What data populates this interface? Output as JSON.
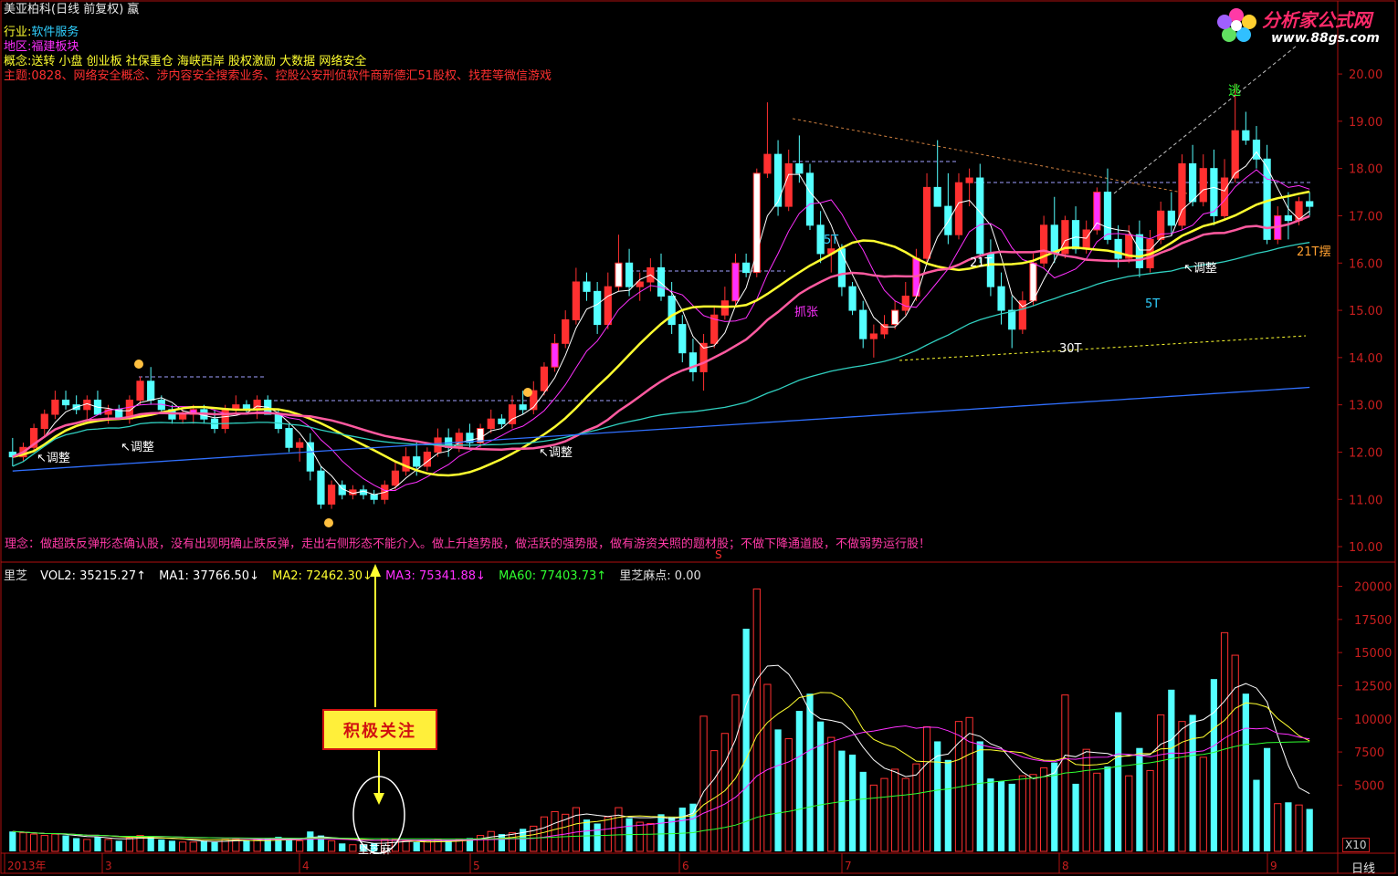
{
  "window": {
    "title": "美亚柏科(日线 前复权) 蠃"
  },
  "info": {
    "industry_label": "行业:",
    "industry_value": "软件服务",
    "region_label": "地区:",
    "region_value": "福建板块",
    "concept_label": "概念:",
    "concept_value": "送转 小盘 创业板 社保重仓 海峡西岸 股权激励 大数据 网络安全",
    "theme_label": "主题:",
    "theme_value": "0828、网络安全概念、涉内容安全搜索业务、控股公安刑侦软件商新德汇51股权、找茬等微信游戏"
  },
  "logo": {
    "text": "分析家公式网",
    "url_text": "www.88gs.com"
  },
  "philosophy": "理念：做超跌反弹形态确认股，没有出现明确止跌反弹，走出右侧形态不能介入。做上升趋势股，做活跃的强势股，做有游资关照的题材股；不做下降通道股，不做弱势运行股！",
  "volume_bar": {
    "indicator": "里芝",
    "vol2": "VOL2: 35215.27↑",
    "ma1": "MA1: 37766.50↓",
    "ma2": "MA2: 72462.30↓",
    "ma3": "MA3: 75341.88↓",
    "ma60": "MA60: 77403.73↑",
    "point": "里芝麻点: 0.00"
  },
  "callout": {
    "text": "积极关注"
  },
  "annotations": {
    "adjust": "↖调整",
    "escape": "逃",
    "grab": "抓张",
    "t5": "5T",
    "t21": "21T",
    "t30": "30T",
    "t21_end": "21T摆",
    "s_marker": "S",
    "vol_marker": "里芝麻"
  },
  "axis": {
    "price_ticks": [
      "20.00",
      "19.00",
      "18.00",
      "17.00",
      "16.00",
      "15.00",
      "14.00",
      "13.00",
      "12.00",
      "11.00",
      "10.00"
    ],
    "volume_ticks": [
      "20000",
      "17500",
      "15000",
      "12500",
      "10000",
      "7500",
      "5000"
    ],
    "x_labels": [
      "2013年",
      "3",
      "4",
      "5",
      "6",
      "7",
      "8",
      "9"
    ],
    "x10": "X10",
    "period": "日线"
  },
  "colors": {
    "up": "#ff3030",
    "down": "#54ffff",
    "ma_white": "#ffffff",
    "ma_yellow": "#ffff30",
    "ma_pink": "#ff5aa0",
    "ma_magenta": "#ff30ff",
    "ma_teal": "#30d0c0",
    "ma_blue": "#3070ff",
    "grid_red": "#b01010"
  },
  "chart_data": {
    "type": "candlestick",
    "ylim": [
      10,
      20.5
    ],
    "bars": [
      [
        12.0,
        12.3,
        11.7,
        11.9
      ],
      [
        11.9,
        12.2,
        11.8,
        12.1
      ],
      [
        12.1,
        12.6,
        12.0,
        12.5
      ],
      [
        12.5,
        12.9,
        12.3,
        12.8
      ],
      [
        12.8,
        13.3,
        12.7,
        13.1
      ],
      [
        13.1,
        13.3,
        12.9,
        13.0
      ],
      [
        13.0,
        13.2,
        12.8,
        12.9
      ],
      [
        12.9,
        13.2,
        12.7,
        13.1
      ],
      [
        13.1,
        13.3,
        12.9,
        12.8
      ],
      [
        12.8,
        13.0,
        12.6,
        12.9
      ],
      [
        12.9,
        13.0,
        12.7,
        12.7
      ],
      [
        12.7,
        13.2,
        12.6,
        13.1
      ],
      [
        13.1,
        13.6,
        13.0,
        13.5
      ],
      [
        13.5,
        13.8,
        13.0,
        13.1
      ],
      [
        13.1,
        13.2,
        12.8,
        12.9
      ],
      [
        12.9,
        13.0,
        12.6,
        12.7
      ],
      [
        12.7,
        12.9,
        12.6,
        12.8
      ],
      [
        12.8,
        13.0,
        12.6,
        12.9
      ],
      [
        12.9,
        13.0,
        12.6,
        12.7
      ],
      [
        12.7,
        12.9,
        12.4,
        12.5
      ],
      [
        12.5,
        13.0,
        12.4,
        12.9
      ],
      [
        12.9,
        13.2,
        12.8,
        13.0
      ],
      [
        13.0,
        13.1,
        12.8,
        12.9
      ],
      [
        12.9,
        13.2,
        12.7,
        13.1
      ],
      [
        13.1,
        13.2,
        12.8,
        12.8
      ],
      [
        12.8,
        12.9,
        12.4,
        12.5
      ],
      [
        12.5,
        12.6,
        12.0,
        12.1
      ],
      [
        12.1,
        12.3,
        11.8,
        12.2
      ],
      [
        12.2,
        12.4,
        11.4,
        11.6
      ],
      [
        11.6,
        11.7,
        10.8,
        10.9
      ],
      [
        10.9,
        11.4,
        10.8,
        11.3
      ],
      [
        11.3,
        11.4,
        11.0,
        11.1
      ],
      [
        11.1,
        11.3,
        11.0,
        11.2
      ],
      [
        11.2,
        11.3,
        11.0,
        11.1
      ],
      [
        11.1,
        11.2,
        10.9,
        11.0
      ],
      [
        11.0,
        11.4,
        10.9,
        11.3
      ],
      [
        11.3,
        11.8,
        11.2,
        11.6
      ],
      [
        11.6,
        12.1,
        11.5,
        11.9
      ],
      [
        11.9,
        12.2,
        11.5,
        11.7
      ],
      [
        11.7,
        12.1,
        11.6,
        12.0
      ],
      [
        12.0,
        12.5,
        11.9,
        12.3
      ],
      [
        12.3,
        12.5,
        11.9,
        12.1
      ],
      [
        12.1,
        12.5,
        12.0,
        12.4
      ],
      [
        12.4,
        12.6,
        12.1,
        12.2
      ],
      [
        12.2,
        12.6,
        12.1,
        12.5
      ],
      [
        12.5,
        12.9,
        12.4,
        12.7
      ],
      [
        12.7,
        12.8,
        12.5,
        12.6
      ],
      [
        12.6,
        13.2,
        12.5,
        13.0
      ],
      [
        13.0,
        13.3,
        12.8,
        12.9
      ],
      [
        12.9,
        13.5,
        12.8,
        13.3
      ],
      [
        13.3,
        13.9,
        13.2,
        13.8
      ],
      [
        13.8,
        14.5,
        13.7,
        14.3
      ],
      [
        14.3,
        15.0,
        14.2,
        14.8
      ],
      [
        14.8,
        15.9,
        14.7,
        15.6
      ],
      [
        15.6,
        15.8,
        15.2,
        15.4
      ],
      [
        15.4,
        15.6,
        14.5,
        14.7
      ],
      [
        14.7,
        15.8,
        14.6,
        15.5
      ],
      [
        15.5,
        16.6,
        15.4,
        16.0
      ],
      [
        16.0,
        16.3,
        15.3,
        15.5
      ],
      [
        15.5,
        15.8,
        15.2,
        15.6
      ],
      [
        15.6,
        16.1,
        15.4,
        15.9
      ],
      [
        15.9,
        16.2,
        15.2,
        15.3
      ],
      [
        15.3,
        15.6,
        14.5,
        14.7
      ],
      [
        14.7,
        14.9,
        13.9,
        14.1
      ],
      [
        14.1,
        14.4,
        13.5,
        13.7
      ],
      [
        13.7,
        14.5,
        13.3,
        14.3
      ],
      [
        14.3,
        15.1,
        14.2,
        14.9
      ],
      [
        14.9,
        15.5,
        14.8,
        15.2
      ],
      [
        15.2,
        16.2,
        15.1,
        16.0
      ],
      [
        16.0,
        16.2,
        15.7,
        15.8
      ],
      [
        15.8,
        18.0,
        15.7,
        17.9
      ],
      [
        17.9,
        19.4,
        17.8,
        18.3
      ],
      [
        18.3,
        18.6,
        17.0,
        17.2
      ],
      [
        17.2,
        18.4,
        17.1,
        18.1
      ],
      [
        18.1,
        18.7,
        17.7,
        17.9
      ],
      [
        17.9,
        18.1,
        16.7,
        16.8
      ],
      [
        16.8,
        17.1,
        16.0,
        16.2
      ],
      [
        16.2,
        16.6,
        15.8,
        16.3
      ],
      [
        16.3,
        16.4,
        15.3,
        15.5
      ],
      [
        15.5,
        15.6,
        14.9,
        15.0
      ],
      [
        15.0,
        15.2,
        14.2,
        14.4
      ],
      [
        14.4,
        14.7,
        14.0,
        14.5
      ],
      [
        14.5,
        14.9,
        14.4,
        14.7
      ],
      [
        14.7,
        15.2,
        14.6,
        15.0
      ],
      [
        15.0,
        15.6,
        14.9,
        15.3
      ],
      [
        15.3,
        16.3,
        15.2,
        16.1
      ],
      [
        16.1,
        17.9,
        16.0,
        17.6
      ],
      [
        17.6,
        18.6,
        17.5,
        17.2
      ],
      [
        17.2,
        17.9,
        16.4,
        16.6
      ],
      [
        16.6,
        17.9,
        16.5,
        17.7
      ],
      [
        17.7,
        18.0,
        17.2,
        17.8
      ],
      [
        17.8,
        18.1,
        16.0,
        16.2
      ],
      [
        16.2,
        16.5,
        15.3,
        15.5
      ],
      [
        15.5,
        15.8,
        14.7,
        15.0
      ],
      [
        15.0,
        15.3,
        14.2,
        14.6
      ],
      [
        14.6,
        15.4,
        14.5,
        15.2
      ],
      [
        15.2,
        16.2,
        15.1,
        16.0
      ],
      [
        16.0,
        17.0,
        15.9,
        16.8
      ],
      [
        16.8,
        17.4,
        16.0,
        16.2
      ],
      [
        16.2,
        17.0,
        16.1,
        16.9
      ],
      [
        16.9,
        17.2,
        16.2,
        16.3
      ],
      [
        16.3,
        16.9,
        16.2,
        16.7
      ],
      [
        16.7,
        17.6,
        16.6,
        17.5
      ],
      [
        17.5,
        18.0,
        16.4,
        16.5
      ],
      [
        16.5,
        16.8,
        15.9,
        16.1
      ],
      [
        16.1,
        16.8,
        16.0,
        16.6
      ],
      [
        16.6,
        16.9,
        15.7,
        15.9
      ],
      [
        15.9,
        16.7,
        15.8,
        16.5
      ],
      [
        16.5,
        17.3,
        16.4,
        17.1
      ],
      [
        17.1,
        17.5,
        16.6,
        16.8
      ],
      [
        16.8,
        18.3,
        16.7,
        18.1
      ],
      [
        18.1,
        18.5,
        17.2,
        17.3
      ],
      [
        17.3,
        18.3,
        17.2,
        18.0
      ],
      [
        18.0,
        18.4,
        16.8,
        17.0
      ],
      [
        17.0,
        18.2,
        16.9,
        17.8
      ],
      [
        17.8,
        19.8,
        17.7,
        18.8
      ],
      [
        18.8,
        19.2,
        18.5,
        18.6
      ],
      [
        18.6,
        18.9,
        18.0,
        18.2
      ],
      [
        18.2,
        18.5,
        16.4,
        16.5
      ],
      [
        16.5,
        17.2,
        16.4,
        17.0
      ],
      [
        17.0,
        17.5,
        16.5,
        16.9
      ],
      [
        16.9,
        17.4,
        16.8,
        17.3
      ],
      [
        17.3,
        17.5,
        17.0,
        17.2
      ]
    ],
    "volume": [
      1500,
      1400,
      1300,
      1200,
      1300,
      1200,
      1000,
      900,
      1100,
      900,
      800,
      1000,
      1200,
      1100,
      900,
      800,
      700,
      700,
      800,
      700,
      900,
      900,
      800,
      900,
      1000,
      1100,
      900,
      800,
      1500,
      1200,
      800,
      600,
      500,
      500,
      600,
      900,
      900,
      800,
      700,
      800,
      900,
      800,
      900,
      1000,
      1200,
      1500,
      1300,
      1400,
      1700,
      1900,
      2600,
      3000,
      2800,
      3300,
      2400,
      2100,
      2600,
      3300,
      2500,
      2200,
      2100,
      2800,
      2600,
      3300,
      3600,
      10200,
      7600,
      8900,
      11800,
      16800,
      19800,
      12600,
      9200,
      8500,
      10600,
      11900,
      9800,
      8600,
      7600,
      7300,
      6000,
      5000,
      5500,
      6200,
      5500,
      6600,
      9400,
      8300,
      6900,
      9800,
      10100,
      8300,
      5500,
      5300,
      5100,
      5700,
      5800,
      6300,
      6700,
      11800,
      5100,
      7700,
      5900,
      6400,
      10500,
      5700,
      7800,
      6100,
      10300,
      12200,
      9800,
      10300,
      7100,
      13000,
      16500,
      14800,
      11900,
      5400,
      7800,
      3600,
      3700,
      3500,
      3200
    ]
  }
}
